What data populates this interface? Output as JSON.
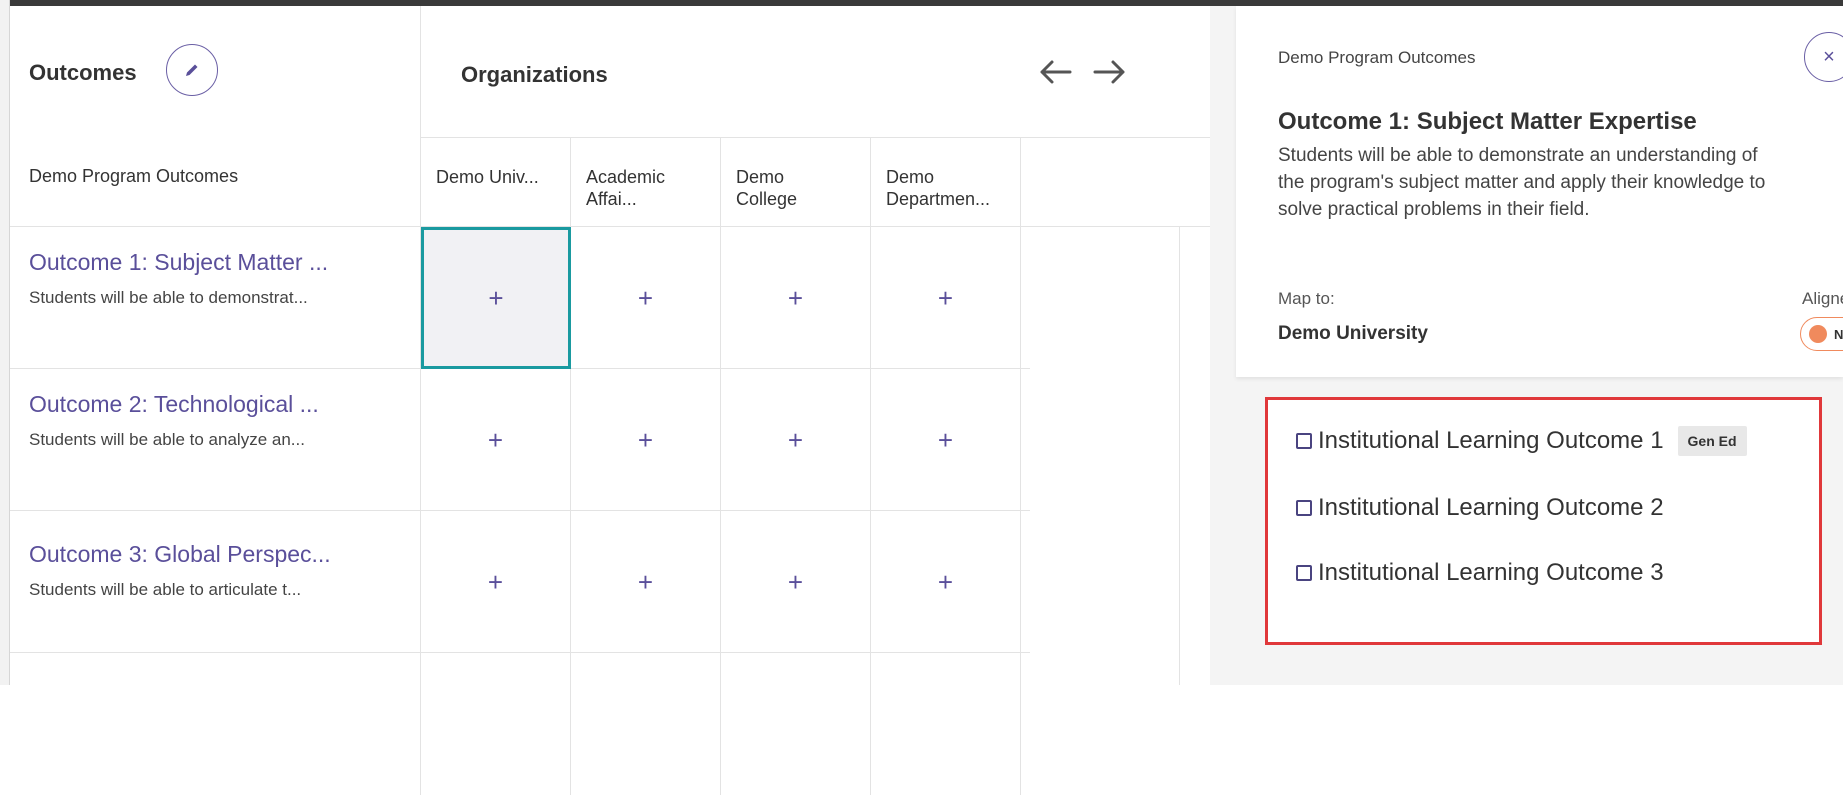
{
  "colors": {
    "accent": "#5a4f9a",
    "selected_cell_border": "#1a9aa0",
    "highlight_box": "#e0383a",
    "toggle_no": "#f08a5d"
  },
  "matrix": {
    "outcomes_title": "Outcomes",
    "edit_icon": "pencil-icon",
    "program_header": "Demo Program Outcomes",
    "organizations_title": "Organizations",
    "nav_prev_icon": "arrow-left-icon",
    "nav_next_icon": "arrow-right-icon",
    "columns": [
      {
        "line1": "Demo Univ...",
        "line2": ""
      },
      {
        "line1": "Academic",
        "line2": "Affai..."
      },
      {
        "line1": "Demo",
        "line2": "College"
      },
      {
        "line1": "Demo",
        "line2": "Departmen..."
      }
    ],
    "rows": [
      {
        "title": "Outcome 1: Subject Matter ...",
        "desc": "Students will be able to demonstrat...",
        "cells": [
          "+",
          "+",
          "+",
          "+"
        ]
      },
      {
        "title": "Outcome 2: Technological ...",
        "desc": "Students will be able to analyze an...",
        "cells": [
          "+",
          "+",
          "+",
          "+"
        ]
      },
      {
        "title": "Outcome 3: Global Perspec...",
        "desc": "Students will be able to articulate t...",
        "cells": [
          "+",
          "+",
          "+",
          "+"
        ]
      }
    ]
  },
  "panel": {
    "program": "Demo Program Outcomes",
    "close_label": "×",
    "outcome_title": "Outcome 1: Subject Matter Expertise",
    "outcome_desc": "Students will be able to demonstrate an understanding of the program's subject matter and apply their knowledge to solve practical problems in their field.",
    "map_to_label": "Map to:",
    "map_to_value": "Demo University",
    "aligned_label": "Aligned:",
    "aligned_value": "NO",
    "ilos": [
      {
        "label": "Institutional Learning Outcome 1",
        "tag": "Gen Ed"
      },
      {
        "label": "Institutional Learning Outcome 2",
        "tag": ""
      },
      {
        "label": "Institutional Learning Outcome 3",
        "tag": ""
      }
    ]
  }
}
